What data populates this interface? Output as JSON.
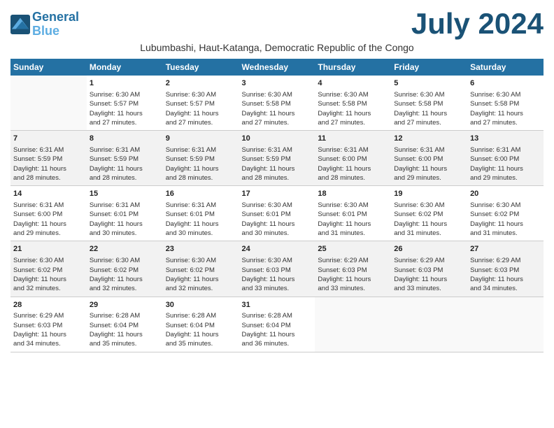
{
  "header": {
    "logo_line1": "General",
    "logo_line2": "Blue",
    "month_year": "July 2024",
    "subtitle": "Lubumbashi, Haut-Katanga, Democratic Republic of the Congo"
  },
  "days_of_week": [
    "Sunday",
    "Monday",
    "Tuesday",
    "Wednesday",
    "Thursday",
    "Friday",
    "Saturday"
  ],
  "weeks": [
    [
      {
        "num": "",
        "info": ""
      },
      {
        "num": "1",
        "info": "Sunrise: 6:30 AM\nSunset: 5:57 PM\nDaylight: 11 hours\nand 27 minutes."
      },
      {
        "num": "2",
        "info": "Sunrise: 6:30 AM\nSunset: 5:57 PM\nDaylight: 11 hours\nand 27 minutes."
      },
      {
        "num": "3",
        "info": "Sunrise: 6:30 AM\nSunset: 5:58 PM\nDaylight: 11 hours\nand 27 minutes."
      },
      {
        "num": "4",
        "info": "Sunrise: 6:30 AM\nSunset: 5:58 PM\nDaylight: 11 hours\nand 27 minutes."
      },
      {
        "num": "5",
        "info": "Sunrise: 6:30 AM\nSunset: 5:58 PM\nDaylight: 11 hours\nand 27 minutes."
      },
      {
        "num": "6",
        "info": "Sunrise: 6:30 AM\nSunset: 5:58 PM\nDaylight: 11 hours\nand 27 minutes."
      }
    ],
    [
      {
        "num": "7",
        "info": "Sunrise: 6:31 AM\nSunset: 5:59 PM\nDaylight: 11 hours\nand 28 minutes."
      },
      {
        "num": "8",
        "info": "Sunrise: 6:31 AM\nSunset: 5:59 PM\nDaylight: 11 hours\nand 28 minutes."
      },
      {
        "num": "9",
        "info": "Sunrise: 6:31 AM\nSunset: 5:59 PM\nDaylight: 11 hours\nand 28 minutes."
      },
      {
        "num": "10",
        "info": "Sunrise: 6:31 AM\nSunset: 5:59 PM\nDaylight: 11 hours\nand 28 minutes."
      },
      {
        "num": "11",
        "info": "Sunrise: 6:31 AM\nSunset: 6:00 PM\nDaylight: 11 hours\nand 28 minutes."
      },
      {
        "num": "12",
        "info": "Sunrise: 6:31 AM\nSunset: 6:00 PM\nDaylight: 11 hours\nand 29 minutes."
      },
      {
        "num": "13",
        "info": "Sunrise: 6:31 AM\nSunset: 6:00 PM\nDaylight: 11 hours\nand 29 minutes."
      }
    ],
    [
      {
        "num": "14",
        "info": "Sunrise: 6:31 AM\nSunset: 6:00 PM\nDaylight: 11 hours\nand 29 minutes."
      },
      {
        "num": "15",
        "info": "Sunrise: 6:31 AM\nSunset: 6:01 PM\nDaylight: 11 hours\nand 30 minutes."
      },
      {
        "num": "16",
        "info": "Sunrise: 6:31 AM\nSunset: 6:01 PM\nDaylight: 11 hours\nand 30 minutes."
      },
      {
        "num": "17",
        "info": "Sunrise: 6:30 AM\nSunset: 6:01 PM\nDaylight: 11 hours\nand 30 minutes."
      },
      {
        "num": "18",
        "info": "Sunrise: 6:30 AM\nSunset: 6:01 PM\nDaylight: 11 hours\nand 31 minutes."
      },
      {
        "num": "19",
        "info": "Sunrise: 6:30 AM\nSunset: 6:02 PM\nDaylight: 11 hours\nand 31 minutes."
      },
      {
        "num": "20",
        "info": "Sunrise: 6:30 AM\nSunset: 6:02 PM\nDaylight: 11 hours\nand 31 minutes."
      }
    ],
    [
      {
        "num": "21",
        "info": "Sunrise: 6:30 AM\nSunset: 6:02 PM\nDaylight: 11 hours\nand 32 minutes."
      },
      {
        "num": "22",
        "info": "Sunrise: 6:30 AM\nSunset: 6:02 PM\nDaylight: 11 hours\nand 32 minutes."
      },
      {
        "num": "23",
        "info": "Sunrise: 6:30 AM\nSunset: 6:02 PM\nDaylight: 11 hours\nand 32 minutes."
      },
      {
        "num": "24",
        "info": "Sunrise: 6:30 AM\nSunset: 6:03 PM\nDaylight: 11 hours\nand 33 minutes."
      },
      {
        "num": "25",
        "info": "Sunrise: 6:29 AM\nSunset: 6:03 PM\nDaylight: 11 hours\nand 33 minutes."
      },
      {
        "num": "26",
        "info": "Sunrise: 6:29 AM\nSunset: 6:03 PM\nDaylight: 11 hours\nand 33 minutes."
      },
      {
        "num": "27",
        "info": "Sunrise: 6:29 AM\nSunset: 6:03 PM\nDaylight: 11 hours\nand 34 minutes."
      }
    ],
    [
      {
        "num": "28",
        "info": "Sunrise: 6:29 AM\nSunset: 6:03 PM\nDaylight: 11 hours\nand 34 minutes."
      },
      {
        "num": "29",
        "info": "Sunrise: 6:28 AM\nSunset: 6:04 PM\nDaylight: 11 hours\nand 35 minutes."
      },
      {
        "num": "30",
        "info": "Sunrise: 6:28 AM\nSunset: 6:04 PM\nDaylight: 11 hours\nand 35 minutes."
      },
      {
        "num": "31",
        "info": "Sunrise: 6:28 AM\nSunset: 6:04 PM\nDaylight: 11 hours\nand 36 minutes."
      },
      {
        "num": "",
        "info": ""
      },
      {
        "num": "",
        "info": ""
      },
      {
        "num": "",
        "info": ""
      }
    ]
  ]
}
